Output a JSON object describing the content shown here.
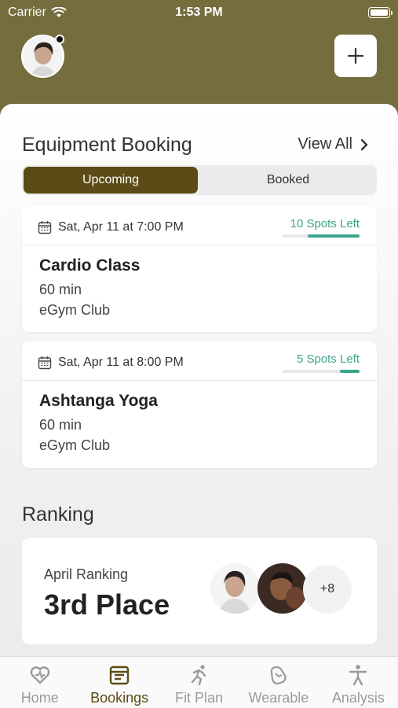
{
  "status_bar": {
    "carrier": "Carrier",
    "time": "1:53 PM"
  },
  "colors": {
    "header": "#756d3d",
    "accent": "#5b4b16",
    "spots": "#3aa58d"
  },
  "equipment": {
    "title": "Equipment Booking",
    "view_all": "View All",
    "tabs": [
      {
        "label": "Upcoming",
        "active": true
      },
      {
        "label": "Booked",
        "active": false
      }
    ],
    "bookings": [
      {
        "date": "Sat, Apr 11 at 7:00 PM",
        "spots": "10 Spots Left",
        "spots_fraction": 0.67,
        "name": "Cardio Class",
        "duration": "60 min",
        "club": "eGym Club"
      },
      {
        "date": "Sat, Apr 11 at 8:00 PM",
        "spots": "5 Spots Left",
        "spots_fraction": 0.26,
        "name": "Ashtanga Yoga",
        "duration": "60 min",
        "club": "eGym Club"
      }
    ]
  },
  "ranking": {
    "title": "Ranking",
    "label": "April Ranking",
    "value": "3rd Place",
    "more": "+8"
  },
  "tabbar": [
    {
      "label": "Home",
      "icon": "heart-icon",
      "active": false
    },
    {
      "label": "Bookings",
      "icon": "calendar-icon",
      "active": true
    },
    {
      "label": "Fit Plan",
      "icon": "runner-icon",
      "active": false
    },
    {
      "label": "Wearable",
      "icon": "watch-icon",
      "active": false
    },
    {
      "label": "Analysis",
      "icon": "person-icon",
      "active": false
    }
  ]
}
